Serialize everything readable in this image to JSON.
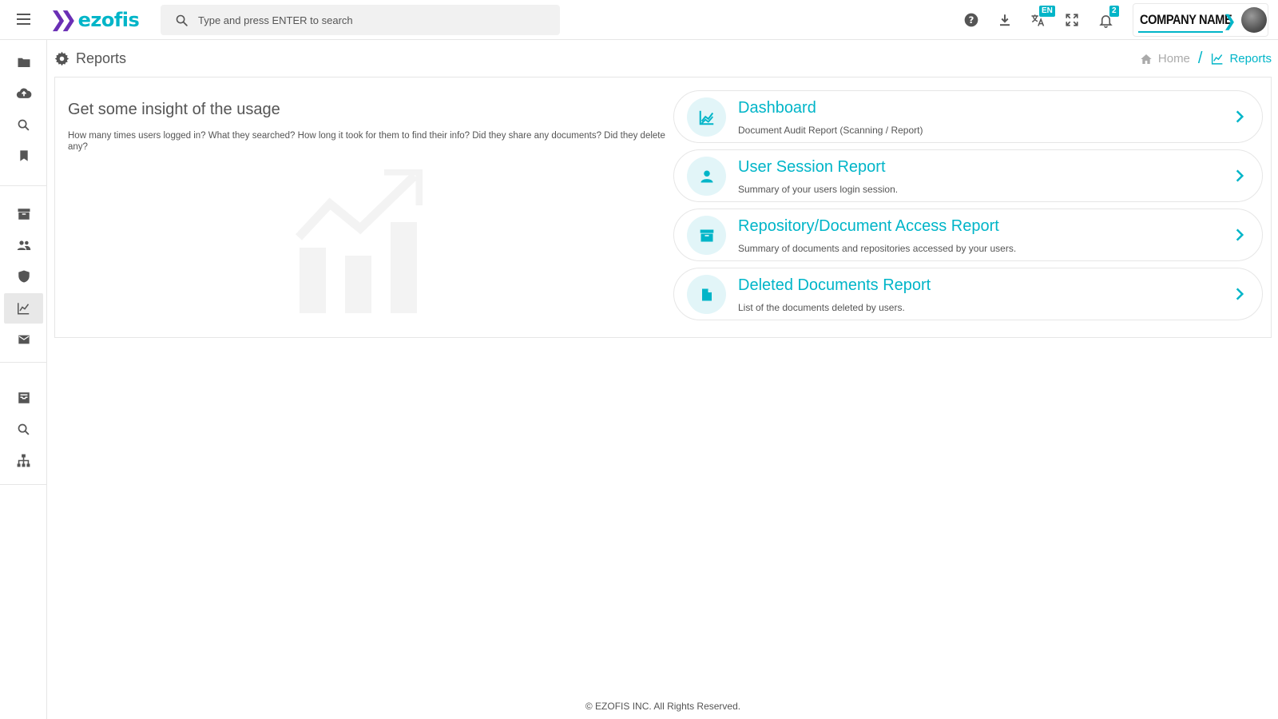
{
  "header": {
    "logo_text": "ezofis",
    "search_placeholder": "Type and press ENTER to search",
    "language_badge": "EN",
    "notification_count": "2",
    "company_name": "COMPANY NAME"
  },
  "sidebar": {
    "items": [
      {
        "icon": "folder-icon"
      },
      {
        "icon": "cloud-upload-icon"
      },
      {
        "icon": "search-icon"
      },
      {
        "icon": "bookmark-icon"
      },
      {
        "icon": "archive-icon"
      },
      {
        "icon": "users-icon"
      },
      {
        "icon": "shield-icon"
      },
      {
        "icon": "reports-chart-icon",
        "active": true
      },
      {
        "icon": "mail-icon"
      },
      {
        "icon": "inbox-icon"
      },
      {
        "icon": "search-icon"
      },
      {
        "icon": "hierarchy-icon"
      }
    ]
  },
  "page": {
    "title": "Reports",
    "breadcrumb": {
      "home": "Home",
      "current": "Reports"
    }
  },
  "insight": {
    "title": "Get some insight of the usage",
    "description": "How many times users logged in? What they searched? How long it took for them to find their info? Did they share any documents? Did they delete any?"
  },
  "reports": [
    {
      "title": "Dashboard",
      "subtitle": "Document Audit Report (Scanning / Report)",
      "icon": "line-chart-icon"
    },
    {
      "title": "User Session Report",
      "subtitle": "Summary of your users login session.",
      "icon": "person-icon"
    },
    {
      "title": "Repository/Document Access Report",
      "subtitle": "Summary of documents and repositories accessed by your users.",
      "icon": "archive-box-icon"
    },
    {
      "title": "Deleted Documents Report",
      "subtitle": "List of the documents deleted by users.",
      "icon": "document-icon"
    }
  ],
  "colors": {
    "accent": "#00b5c8",
    "brand_purple": "#6a2fb5",
    "icon_bg": "#e2f5f8"
  },
  "footer": {
    "copyright": "© EZOFIS INC. All Rights Reserved."
  }
}
